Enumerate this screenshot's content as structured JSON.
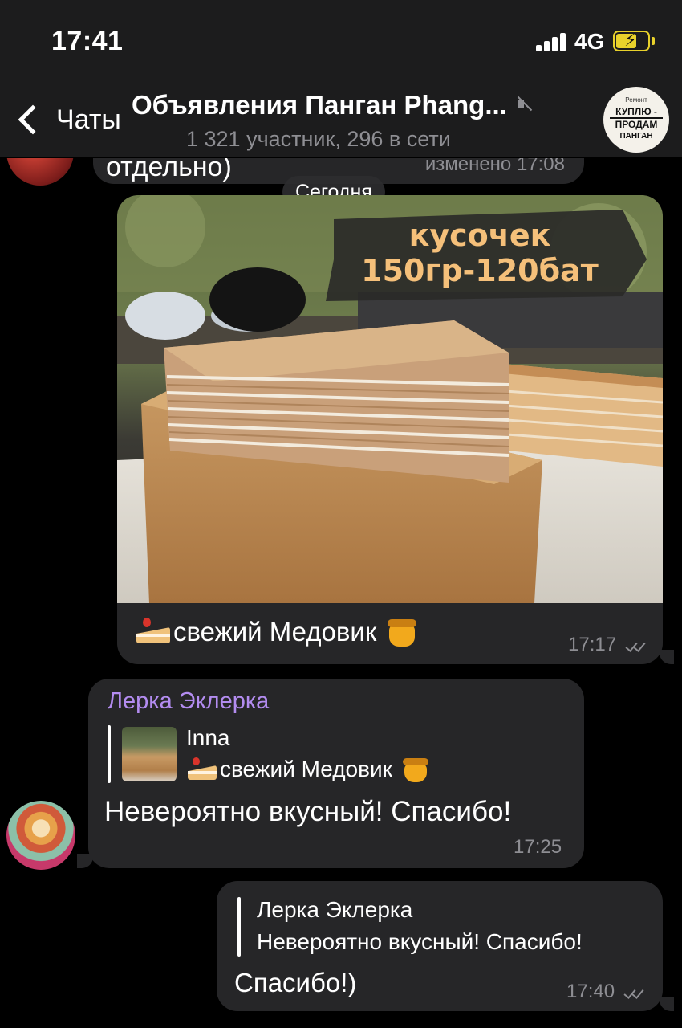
{
  "status": {
    "time": "17:41",
    "network": "4G"
  },
  "header": {
    "back_label": "Чаты",
    "title": "Объявления Панган Phang...",
    "subtitle": "1 321 участник, 296 в сети",
    "avatar_text": {
      "top": "Ремонт",
      "line1": "КУПЛЮ -",
      "line2": "ПРОДАМ",
      "line3": "ПАНГАН"
    }
  },
  "messages": {
    "previous": {
      "text": "отдельно)",
      "time": "изменено 17:08"
    },
    "date_separator": "Сегодня",
    "post": {
      "image_overlay": {
        "line1": "кусочек",
        "line2": "150гр-120бат"
      },
      "caption": "свежий Медовик",
      "time": "17:17"
    },
    "reply1": {
      "sender": "Лерка Эклерка",
      "quoted_name": "Inna",
      "quoted_text": "свежий Медовик",
      "text": "Невероятно вкусный! Спасибо!",
      "time": "17:25"
    },
    "reply2": {
      "quoted_name": "Лерка Эклерка",
      "quoted_text": "Невероятно вкусный! Спасибо!",
      "text": "Спасибо!)",
      "time": "17:40"
    }
  },
  "icons": [
    "signal-icon",
    "battery-icon",
    "back-chevron-icon",
    "mute-icon",
    "read-checks-icon",
    "cake-emoji-icon",
    "honey-pot-emoji-icon"
  ],
  "colors": {
    "bubble": "#262628",
    "sender_name": "#b38cf0",
    "battery": "#e8d12b",
    "muted_text": "#8e8e93"
  }
}
